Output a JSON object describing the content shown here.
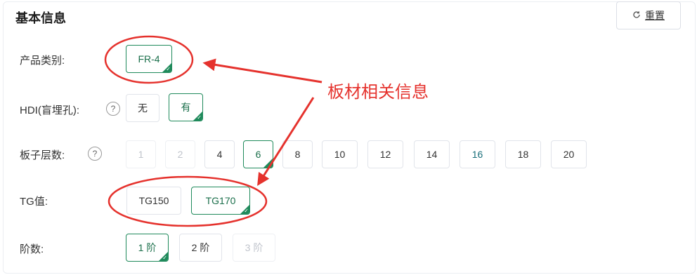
{
  "section": {
    "title": "基本信息",
    "reset_label": "重置",
    "reset_icon": "refresh-icon"
  },
  "rows": {
    "product_type": {
      "label": "产品类别:",
      "options": [
        {
          "label": "FR-4",
          "selected": true
        }
      ]
    },
    "hdi": {
      "label": "HDI(盲埋孔):",
      "help": "?",
      "options": [
        {
          "label": "无",
          "selected": false
        },
        {
          "label": "有",
          "selected": true
        }
      ]
    },
    "layers": {
      "label": "板子层数:",
      "help": "?",
      "options": [
        {
          "label": "1",
          "state": "disabled"
        },
        {
          "label": "2",
          "state": "disabled"
        },
        {
          "label": "4",
          "state": "normal"
        },
        {
          "label": "6",
          "state": "selected"
        },
        {
          "label": "8",
          "state": "normal"
        },
        {
          "label": "10",
          "state": "normal"
        },
        {
          "label": "12",
          "state": "normal"
        },
        {
          "label": "14",
          "state": "normal"
        },
        {
          "label": "16",
          "state": "normal"
        },
        {
          "label": "18",
          "state": "normal"
        },
        {
          "label": "20",
          "state": "normal"
        }
      ]
    },
    "tg": {
      "label": "TG值:",
      "options": [
        {
          "label": "TG150",
          "selected": false
        },
        {
          "label": "TG170",
          "selected": true
        }
      ]
    },
    "order": {
      "label": "阶数:",
      "options": [
        {
          "label": "1 阶",
          "state": "selected"
        },
        {
          "label": "2 阶",
          "state": "normal"
        },
        {
          "label": "3 阶",
          "state": "disabled"
        }
      ]
    }
  },
  "annotation": {
    "text": "板材相关信息",
    "color": "#e5322d"
  },
  "colors": {
    "selected_border": "#1f8a5b",
    "selected_text": "#1b6f4b"
  }
}
